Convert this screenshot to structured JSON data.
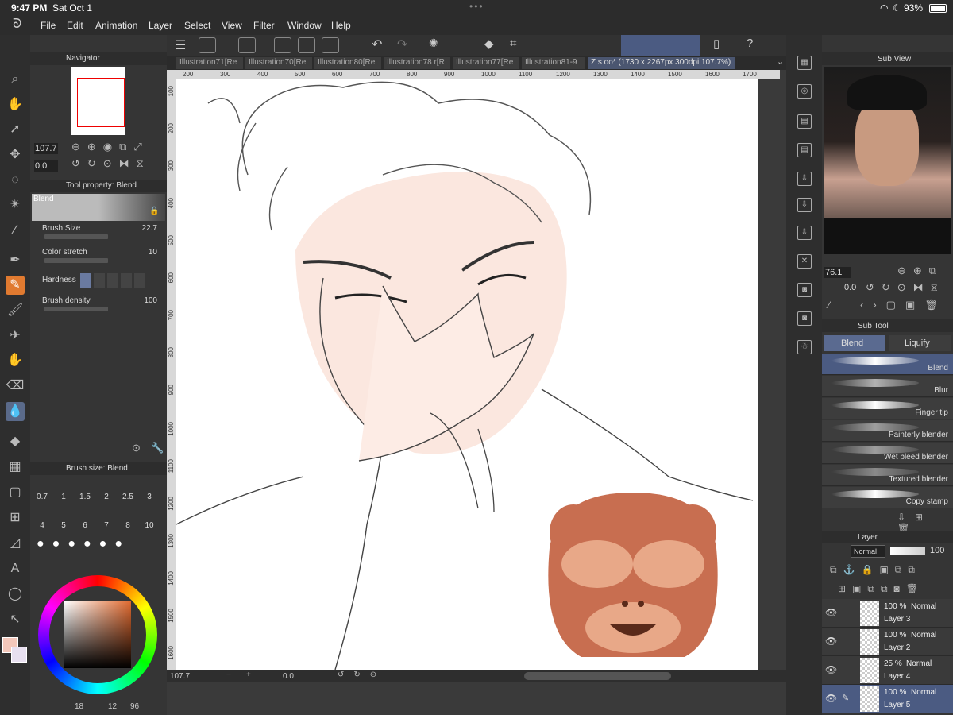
{
  "status": {
    "time": "9:47 PM",
    "date": "Sat Oct 1",
    "battery": "93%"
  },
  "menu": [
    "File",
    "Edit",
    "Animation",
    "Layer",
    "Select",
    "View",
    "Filter",
    "Window",
    "Help"
  ],
  "tabs": [
    {
      "label": "Illustration71[Re"
    },
    {
      "label": "Illustration70[Re"
    },
    {
      "label": "Illustration80[Re"
    },
    {
      "label": "Illustration78 r[R"
    },
    {
      "label": "Illustration77[Re"
    },
    {
      "label": "Illustration81-9"
    },
    {
      "label": "Z s oo* (1730 x 2267px 300dpi 107.7%)"
    }
  ],
  "ruler_top": [
    "200",
    "300",
    "400",
    "500",
    "600",
    "700",
    "800",
    "900",
    "1000",
    "1100",
    "1200",
    "1300",
    "1400",
    "1500",
    "1600",
    "1700"
  ],
  "ruler_left": [
    "100",
    "200",
    "300",
    "400",
    "500",
    "600",
    "700",
    "800",
    "900",
    "1000",
    "1100",
    "1200",
    "1300",
    "1400",
    "1500",
    "1600"
  ],
  "navigator": {
    "title": "Navigator",
    "zoom": "107.7",
    "rotation": "0.0"
  },
  "tool_property": {
    "title": "Tool property: Blend",
    "name": "Blend",
    "brush_size_label": "Brush Size",
    "brush_size": "22.7",
    "color_stretch_label": "Color stretch",
    "color_stretch": "10",
    "hardness_label": "Hardness",
    "brush_density_label": "Brush density",
    "brush_density": "100"
  },
  "brush_size_panel": {
    "title": "Brush size: Blend",
    "sizes": [
      "0.7",
      "1",
      "1.5",
      "2",
      "2.5",
      "3",
      "4",
      "5",
      "6",
      "7",
      "8",
      "10"
    ]
  },
  "color_panel": {
    "h": "18",
    "s": "12",
    "v": "96",
    "main_color": "#f4c8bb",
    "sub_color": "#e8e0f0"
  },
  "canvas_bar": {
    "zoom": "107.7",
    "rotation": "0.0"
  },
  "sub_view": {
    "title": "Sub View",
    "zoom": "76.1",
    "rotation": "0.0"
  },
  "sub_tool": {
    "title": "Sub Tool",
    "groups": [
      "Blend",
      "Liquify"
    ],
    "items": [
      "Blend",
      "Blur",
      "Finger tip",
      "Painterly blender",
      "Wet bleed blender",
      "Textured blender",
      "Copy stamp"
    ]
  },
  "layer_panel": {
    "title": "Layer",
    "blend_mode": "Normal",
    "opacity": "100",
    "layers": [
      {
        "opacity": "100 %",
        "mode": "Normal",
        "name": "Layer 3"
      },
      {
        "opacity": "100 %",
        "mode": "Normal",
        "name": "Layer 2"
      },
      {
        "opacity": "25 %",
        "mode": "Normal",
        "name": "Layer 4"
      },
      {
        "opacity": "100 %",
        "mode": "Normal",
        "name": "Layer 5"
      }
    ]
  },
  "colors": {
    "accent": "#4b5b82",
    "skin": "#f9e4dc",
    "monkey": "#c86e50"
  }
}
